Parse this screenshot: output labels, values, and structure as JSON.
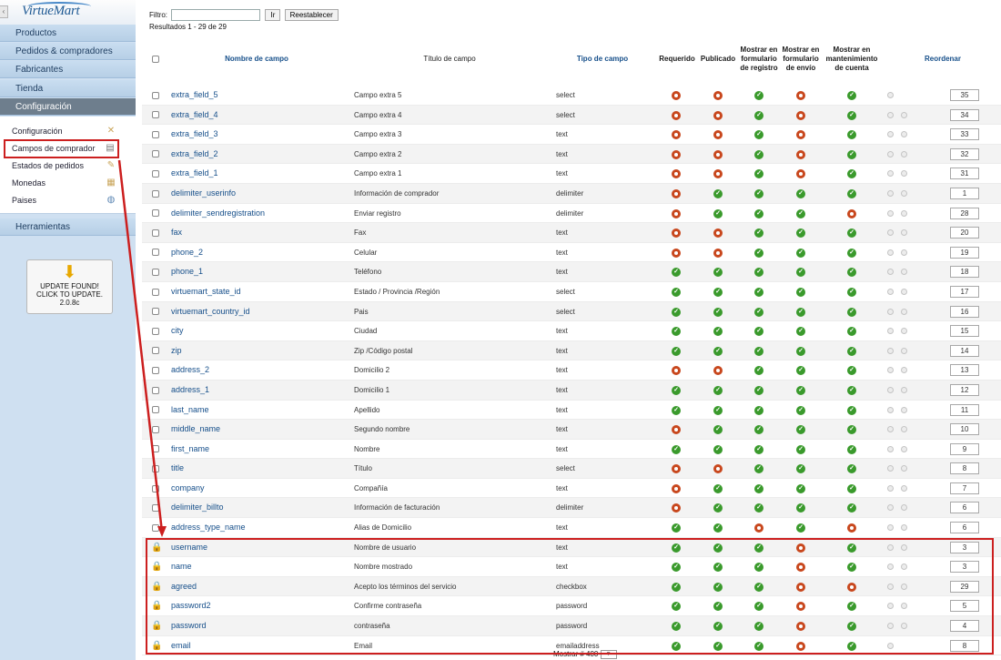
{
  "sidebar": {
    "logo": "VirtueMart",
    "collapse": "‹",
    "menu": [
      {
        "label": "Productos"
      },
      {
        "label": "Pedidos & compradores"
      },
      {
        "label": "Fabricantes"
      },
      {
        "label": "Tienda"
      },
      {
        "label": "Configuración"
      }
    ],
    "submenu": [
      {
        "label": "Configuración",
        "icon": "✕"
      },
      {
        "label": "Campos de comprador",
        "icon": "▤"
      },
      {
        "label": "Estados de pedidos",
        "icon": "✎"
      },
      {
        "label": "Monedas",
        "icon": "▦"
      },
      {
        "label": "Paises",
        "icon": "◍"
      }
    ],
    "tools": "Herramientas",
    "update": {
      "arrow": "⬇",
      "line1": "UPDATE FOUND!",
      "line2": "CLICK TO UPDATE.",
      "line3": "2.0.8c"
    }
  },
  "filter": {
    "label": "Filtro:",
    "value": "",
    "go": "Ir",
    "reset": "Reestablecer",
    "results": "Resultados 1 - 29 de 29"
  },
  "columns": {
    "name": "Nombre de campo",
    "title": "Título de campo",
    "type": "Tipo de campo",
    "required": "Requerido",
    "published": "Publicado",
    "registration": "Mostrar en formulario de registro",
    "shipment": "Mostrar en formulario de envío",
    "account": "Mostrar en mantenimiento de cuenta",
    "reorder": "Reordenar"
  },
  "status_colors": {
    "ok": "#3a9a2c",
    "no": "#c8471d"
  },
  "rows": [
    {
      "name": "extra_field_5",
      "title": "Campo extra 5",
      "type": "select",
      "locked": false,
      "flags": [
        0,
        0,
        1,
        0,
        1
      ],
      "order": "35",
      "arrows": 1
    },
    {
      "name": "extra_field_4",
      "title": "Campo extra 4",
      "type": "select",
      "locked": false,
      "flags": [
        0,
        0,
        1,
        0,
        1
      ],
      "order": "34",
      "arrows": 2
    },
    {
      "name": "extra_field_3",
      "title": "Campo extra 3",
      "type": "text",
      "locked": false,
      "flags": [
        0,
        0,
        1,
        0,
        1
      ],
      "order": "33",
      "arrows": 2
    },
    {
      "name": "extra_field_2",
      "title": "Campo extra 2",
      "type": "text",
      "locked": false,
      "flags": [
        0,
        0,
        1,
        0,
        1
      ],
      "order": "32",
      "arrows": 2
    },
    {
      "name": "extra_field_1",
      "title": "Campo extra 1",
      "type": "text",
      "locked": false,
      "flags": [
        0,
        0,
        1,
        0,
        1
      ],
      "order": "31",
      "arrows": 2
    },
    {
      "name": "delimiter_userinfo",
      "title": "Información de comprador",
      "type": "delimiter",
      "locked": false,
      "flags": [
        0,
        1,
        1,
        1,
        1
      ],
      "order": "1",
      "arrows": 2
    },
    {
      "name": "delimiter_sendregistration",
      "title": "Enviar registro",
      "type": "delimiter",
      "locked": false,
      "flags": [
        0,
        1,
        1,
        1,
        0
      ],
      "order": "28",
      "arrows": 2
    },
    {
      "name": "fax",
      "title": "Fax",
      "type": "text",
      "locked": false,
      "flags": [
        0,
        0,
        1,
        1,
        1
      ],
      "order": "20",
      "arrows": 2
    },
    {
      "name": "phone_2",
      "title": "Celular",
      "type": "text",
      "locked": false,
      "flags": [
        0,
        0,
        1,
        1,
        1
      ],
      "order": "19",
      "arrows": 2
    },
    {
      "name": "phone_1",
      "title": "Teléfono",
      "type": "text",
      "locked": false,
      "flags": [
        1,
        1,
        1,
        1,
        1
      ],
      "order": "18",
      "arrows": 2
    },
    {
      "name": "virtuemart_state_id",
      "title": "Estado / Provincia /Región",
      "type": "select",
      "locked": false,
      "flags": [
        1,
        1,
        1,
        1,
        1
      ],
      "order": "17",
      "arrows": 2
    },
    {
      "name": "virtuemart_country_id",
      "title": "Pais",
      "type": "select",
      "locked": false,
      "flags": [
        1,
        1,
        1,
        1,
        1
      ],
      "order": "16",
      "arrows": 2
    },
    {
      "name": "city",
      "title": "Ciudad",
      "type": "text",
      "locked": false,
      "flags": [
        1,
        1,
        1,
        1,
        1
      ],
      "order": "15",
      "arrows": 2
    },
    {
      "name": "zip",
      "title": "Zip /Código postal",
      "type": "text",
      "locked": false,
      "flags": [
        1,
        1,
        1,
        1,
        1
      ],
      "order": "14",
      "arrows": 2
    },
    {
      "name": "address_2",
      "title": "Domicilio 2",
      "type": "text",
      "locked": false,
      "flags": [
        0,
        0,
        1,
        1,
        1
      ],
      "order": "13",
      "arrows": 2
    },
    {
      "name": "address_1",
      "title": "Domicilio 1",
      "type": "text",
      "locked": false,
      "flags": [
        1,
        1,
        1,
        1,
        1
      ],
      "order": "12",
      "arrows": 2
    },
    {
      "name": "last_name",
      "title": "Apellido",
      "type": "text",
      "locked": false,
      "flags": [
        1,
        1,
        1,
        1,
        1
      ],
      "order": "11",
      "arrows": 2
    },
    {
      "name": "middle_name",
      "title": "Segundo nombre",
      "type": "text",
      "locked": false,
      "flags": [
        0,
        1,
        1,
        1,
        1
      ],
      "order": "10",
      "arrows": 2
    },
    {
      "name": "first_name",
      "title": "Nombre",
      "type": "text",
      "locked": false,
      "flags": [
        1,
        1,
        1,
        1,
        1
      ],
      "order": "9",
      "arrows": 2
    },
    {
      "name": "title",
      "title": "Título",
      "type": "select",
      "locked": false,
      "flags": [
        0,
        0,
        1,
        1,
        1
      ],
      "order": "8",
      "arrows": 2
    },
    {
      "name": "company",
      "title": "Compañía",
      "type": "text",
      "locked": false,
      "flags": [
        0,
        1,
        1,
        1,
        1
      ],
      "order": "7",
      "arrows": 2
    },
    {
      "name": "delimiter_billto",
      "title": "Información de facturación",
      "type": "delimiter",
      "locked": false,
      "flags": [
        0,
        1,
        1,
        1,
        1
      ],
      "order": "6",
      "arrows": 2
    },
    {
      "name": "address_type_name",
      "title": "Alias de Domicilio",
      "type": "text",
      "locked": false,
      "flags": [
        1,
        1,
        0,
        1,
        0
      ],
      "order": "6",
      "arrows": 2
    },
    {
      "name": "username",
      "title": "Nombre de usuario",
      "type": "text",
      "locked": true,
      "flags": [
        1,
        1,
        1,
        0,
        1
      ],
      "order": "3",
      "arrows": 2
    },
    {
      "name": "name",
      "title": "Nombre mostrado",
      "type": "text",
      "locked": true,
      "flags": [
        1,
        1,
        1,
        0,
        1
      ],
      "order": "3",
      "arrows": 2
    },
    {
      "name": "agreed",
      "title": "Acepto los términos del servicio",
      "type": "checkbox",
      "locked": true,
      "flags": [
        1,
        1,
        1,
        0,
        0
      ],
      "order": "29",
      "arrows": 2
    },
    {
      "name": "password2",
      "title": "Confirme contraseña",
      "type": "password",
      "locked": true,
      "flags": [
        1,
        1,
        1,
        0,
        1
      ],
      "order": "5",
      "arrows": 2
    },
    {
      "name": "password",
      "title": "contraseña",
      "type": "password",
      "locked": true,
      "flags": [
        1,
        1,
        1,
        0,
        1
      ],
      "order": "4",
      "arrows": 2
    },
    {
      "name": "email",
      "title": "Email",
      "type": "emailaddress",
      "locked": true,
      "flags": [
        1,
        1,
        1,
        0,
        1
      ],
      "order": "8",
      "arrows": 1
    }
  ],
  "footer": {
    "label": "Mostrar # 400",
    "arrow": "▾"
  },
  "icons": {
    "lock": "🔒",
    "check": "✓"
  }
}
